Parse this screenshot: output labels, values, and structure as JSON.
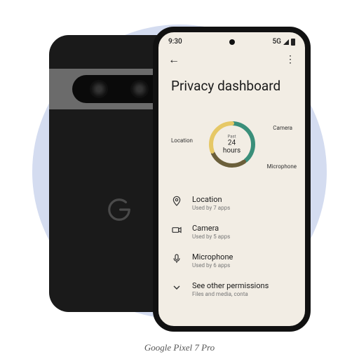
{
  "caption": "Google Pixel 7 Pro",
  "statusBar": {
    "time": "9:30",
    "network": "5G"
  },
  "page": {
    "title": "Privacy dashboard"
  },
  "chart": {
    "centerTop": "Past",
    "centerBottom": "24 hours",
    "labels": {
      "location": "Location",
      "camera": "Camera",
      "microphone": "Microphone"
    }
  },
  "permissions": {
    "location": {
      "title": "Location",
      "sub": "Used by 7 apps"
    },
    "camera": {
      "title": "Camera",
      "sub": "Used by 5 apps"
    },
    "microphone": {
      "title": "Microphone",
      "sub": "Used by 6 apps"
    },
    "other": {
      "title": "See other permissions",
      "sub": "Files and media, conta"
    }
  },
  "chart_data": {
    "type": "pie",
    "title": "Past 24 hours",
    "series": [
      {
        "name": "Location",
        "value": 7,
        "color": "#3a8f7a"
      },
      {
        "name": "Camera",
        "value": 5,
        "color": "#6b5f3a"
      },
      {
        "name": "Microphone",
        "value": 6,
        "color": "#e6c866"
      }
    ]
  },
  "colors": {
    "bgCircle": "#d4dcf0",
    "screenBg": "#f2ede4",
    "phoneBody": "#1a1a1a"
  }
}
